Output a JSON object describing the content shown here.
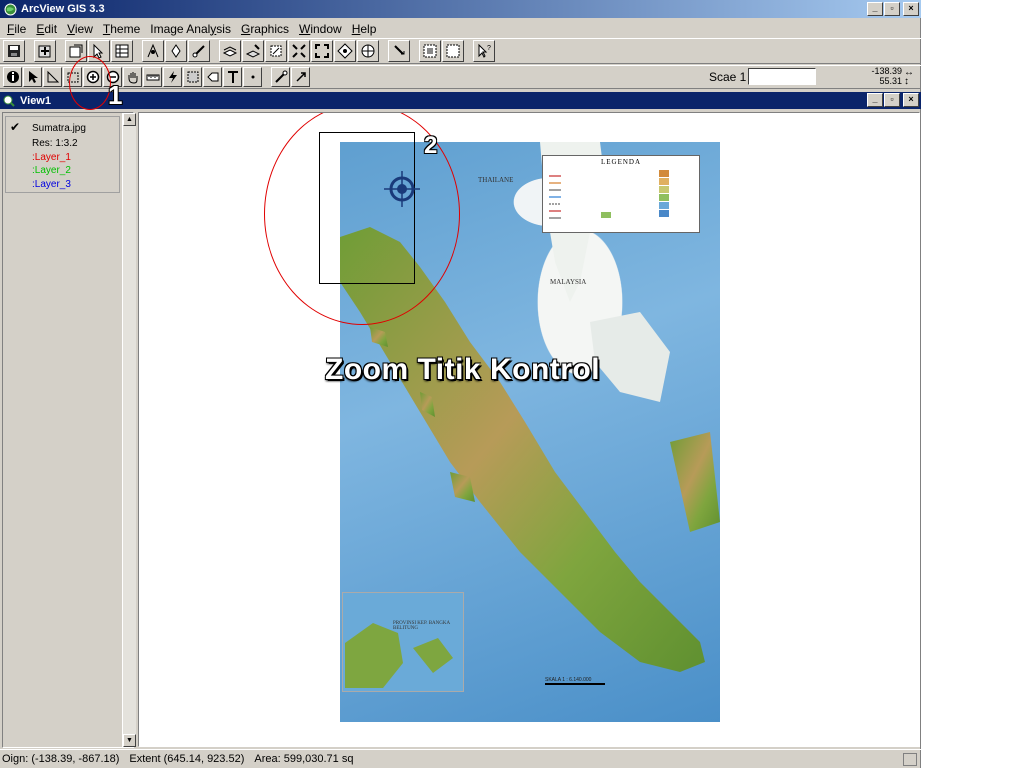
{
  "app": {
    "title": "ArcView GIS 3.3"
  },
  "menu": [
    {
      "pre": "",
      "u": "F",
      "post": "ile"
    },
    {
      "pre": "",
      "u": "E",
      "post": "dit"
    },
    {
      "pre": "",
      "u": "V",
      "post": "iew"
    },
    {
      "pre": "",
      "u": "T",
      "post": "heme"
    },
    {
      "pre": "Image Anal",
      "u": "y",
      "post": "sis"
    },
    {
      "pre": "",
      "u": "G",
      "post": "raphics"
    },
    {
      "pre": "",
      "u": "W",
      "post": "indow"
    },
    {
      "pre": "",
      "u": "H",
      "post": "elp"
    }
  ],
  "scale": {
    "label": "Scae 1",
    "value": ""
  },
  "coords": {
    "x": "-138.39",
    "y": "55.31"
  },
  "view": {
    "title": "View1"
  },
  "toc": {
    "theme": "Sumatra.jpg",
    "res": "Res: 1:3.2",
    "layer1": "Layer_1",
    "layer2": "Layer_2",
    "layer3": "Layer_3",
    "checked": true
  },
  "map": {
    "legend_title": "LEGENDA",
    "label_thailand": "THAILANE",
    "label_malaysia": "MALAYSIA",
    "scale_text": "SKALA 1 : 6.140.000",
    "inset_label": "PROVINSI KEP. BANGKA BELITUNG"
  },
  "annotations": {
    "zoom_text": "Zoom Titik Kontrol",
    "marker1": "1",
    "marker2": "2"
  },
  "status": {
    "origin": "Oign: (-138.39, -867.18)",
    "extent": "Extent (645.14, 923.52)",
    "area": "Area: 599,030.71 sq"
  },
  "colors": {
    "title_active": "#0a246a",
    "annotation_circle": "#e00000"
  }
}
